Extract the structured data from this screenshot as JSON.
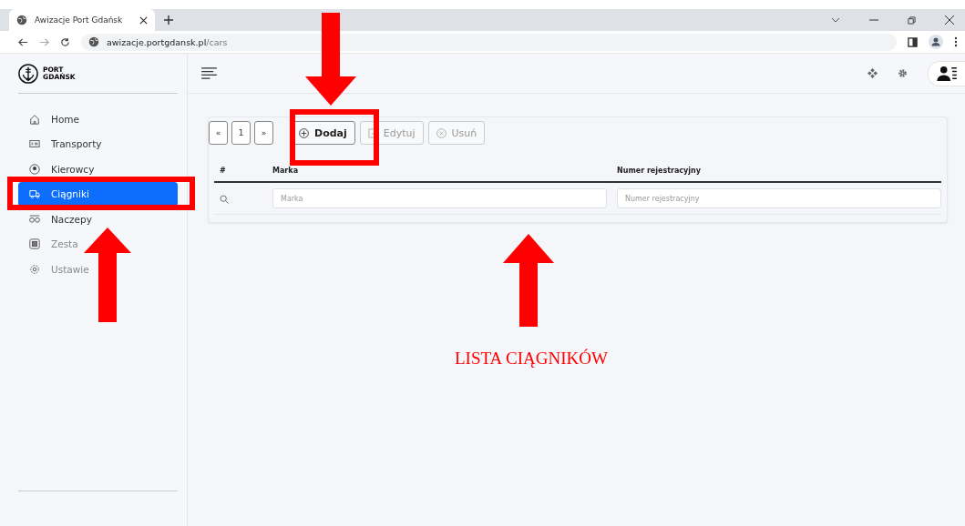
{
  "browser": {
    "tab_title": "Awizacje Port Gdańsk",
    "url_host": "awizacje.portgdansk.pl",
    "url_path": "/cars"
  },
  "sidebar": {
    "logo_lines": [
      "PORT",
      "GDAŃSK"
    ],
    "items": [
      {
        "label": "Home",
        "kind": "home",
        "selected": false,
        "disabled": false
      },
      {
        "label": "Transporty",
        "kind": "card",
        "selected": false,
        "disabled": false
      },
      {
        "label": "Kierowcy",
        "kind": "person",
        "selected": false,
        "disabled": false
      },
      {
        "label": "Ciągniki",
        "kind": "truck",
        "selected": true,
        "disabled": false
      },
      {
        "label": "Naczepy",
        "kind": "trailer",
        "selected": false,
        "disabled": false
      },
      {
        "label": "Zesta",
        "kind": "set",
        "selected": false,
        "disabled": true
      },
      {
        "label": "Ustawie",
        "kind": "gear",
        "selected": false,
        "disabled": true
      }
    ]
  },
  "pagination": [
    {
      "label": "«"
    },
    {
      "label": "1"
    },
    {
      "label": "»"
    }
  ],
  "toolbar": [
    {
      "label": "Dodaj",
      "kind": "add",
      "disabled": false
    },
    {
      "label": "Edytuj",
      "kind": "edit",
      "disabled": true
    },
    {
      "label": "Usuń",
      "kind": "delete",
      "disabled": true
    }
  ],
  "table": {
    "columns": [
      "#",
      "Marka",
      "Numer rejestracyjny"
    ],
    "filters": [
      {
        "placeholder": "Marka"
      },
      {
        "placeholder": "Numer rejestracyjny"
      }
    ]
  },
  "annotation": {
    "caption": "LISTA CIĄGNIKÓW"
  }
}
